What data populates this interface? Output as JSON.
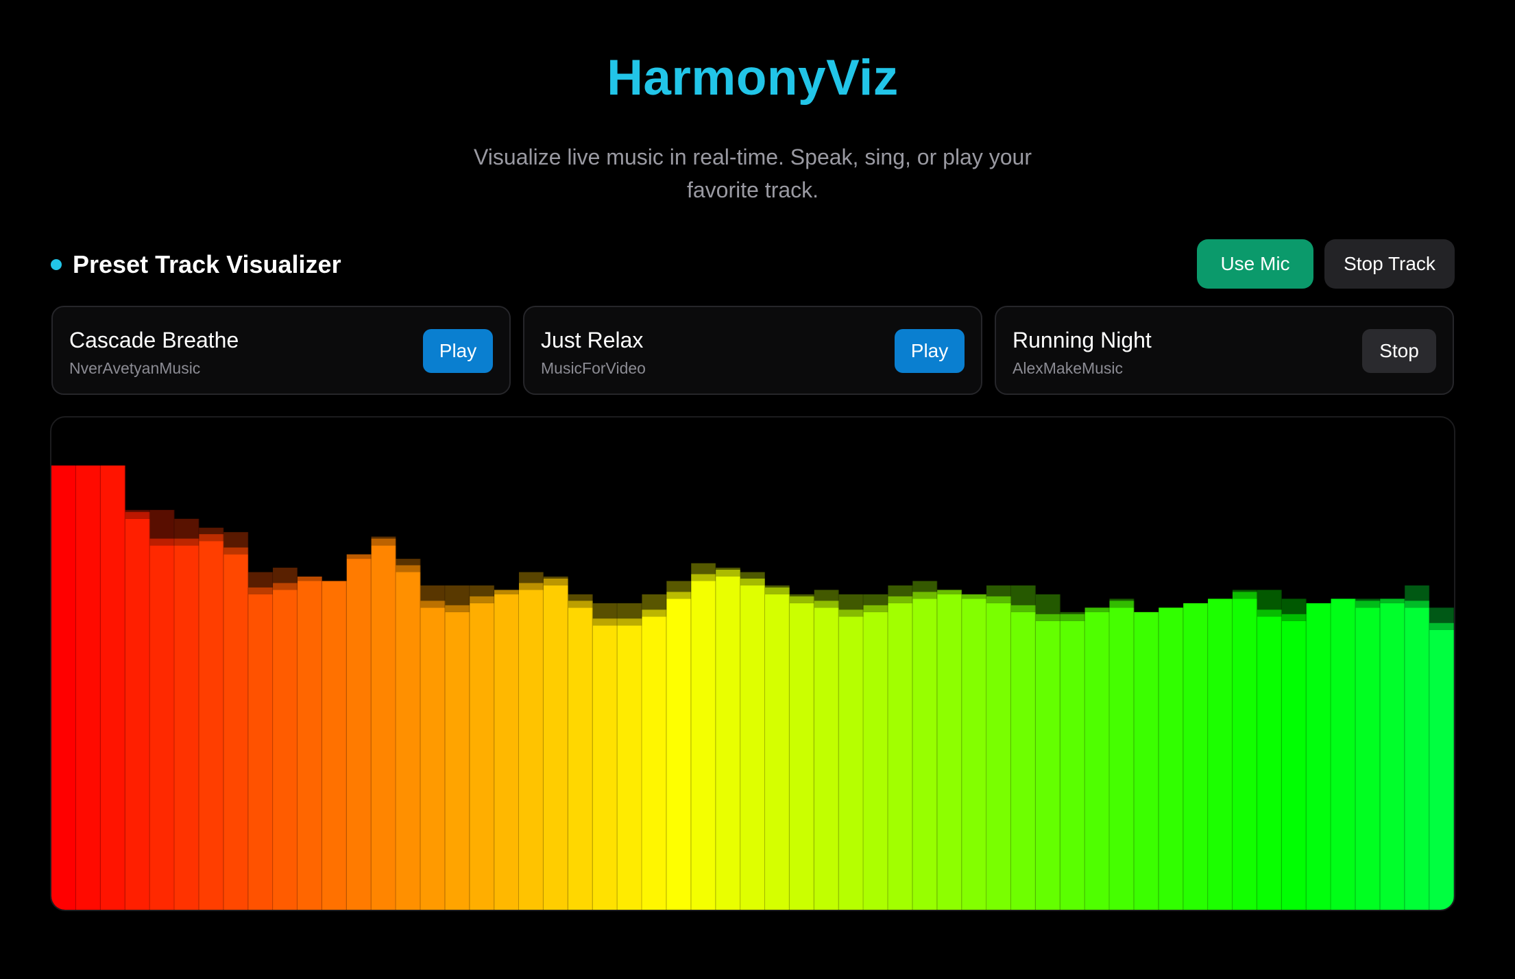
{
  "app": {
    "title": "HarmonyViz",
    "subtitle": "Visualize live music in real-time. Speak, sing, or play your favorite track.",
    "accent_color": "#22c5e8"
  },
  "section": {
    "title": "Preset Track Visualizer",
    "status_icon": "dot-indicator-icon"
  },
  "controls": {
    "use_mic_label": "Use Mic",
    "use_mic_color": "#0b9a6b",
    "stop_track_label": "Stop Track"
  },
  "tracks": [
    {
      "name": "Cascade Breathe",
      "artist": "NverAvetyanMusic",
      "action": "Play",
      "state": "idle"
    },
    {
      "name": "Just Relax",
      "artist": "MusicForVideo",
      "action": "Play",
      "state": "idle"
    },
    {
      "name": "Running Night",
      "artist": "AlexMakeMusic",
      "action": "Stop",
      "state": "playing"
    }
  ],
  "visualizer": {
    "type": "frequency-bars",
    "bar_count": 57,
    "levels": [
      1.0,
      1.0,
      1.0,
      0.88,
      0.82,
      0.82,
      0.83,
      0.8,
      0.71,
      0.72,
      0.74,
      0.74,
      0.79,
      0.82,
      0.76,
      0.68,
      0.67,
      0.69,
      0.71,
      0.72,
      0.73,
      0.68,
      0.64,
      0.64,
      0.66,
      0.7,
      0.74,
      0.75,
      0.73,
      0.71,
      0.69,
      0.68,
      0.66,
      0.67,
      0.69,
      0.7,
      0.71,
      0.7,
      0.69,
      0.67,
      0.65,
      0.65,
      0.67,
      0.68,
      0.67,
      0.68,
      0.69,
      0.7,
      0.7,
      0.66,
      0.65,
      0.69,
      0.7,
      0.68,
      0.69,
      0.68,
      0.63
    ],
    "peaks": [
      1.0,
      1.0,
      1.0,
      0.9,
      0.9,
      0.88,
      0.86,
      0.85,
      0.76,
      0.77,
      0.75,
      0.74,
      0.8,
      0.84,
      0.79,
      0.73,
      0.73,
      0.73,
      0.72,
      0.76,
      0.75,
      0.71,
      0.69,
      0.69,
      0.71,
      0.74,
      0.78,
      0.77,
      0.76,
      0.73,
      0.71,
      0.72,
      0.71,
      0.71,
      0.73,
      0.74,
      0.72,
      0.71,
      0.73,
      0.73,
      0.71,
      0.67,
      0.68,
      0.7,
      0.67,
      0.68,
      0.69,
      0.7,
      0.72,
      0.72,
      0.7,
      0.69,
      0.7,
      0.7,
      0.7,
      0.73,
      0.68
    ],
    "hue_start": 0,
    "hue_end": 135
  }
}
